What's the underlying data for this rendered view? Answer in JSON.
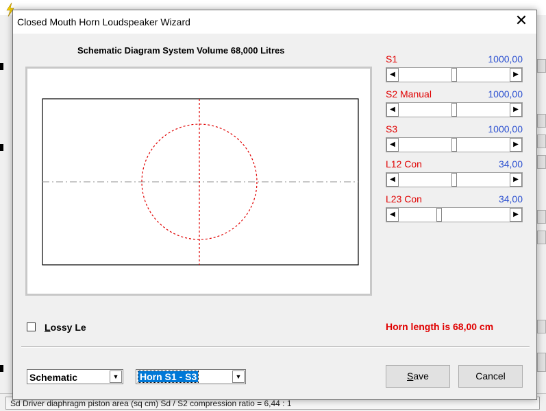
{
  "background": {
    "status_text": "Sd   Driver diaphragm piston area (sq cm)   Sd / S2 compression ratio = 6,44 : 1"
  },
  "dialog": {
    "title": "Closed Mouth Horn Loudspeaker Wizard",
    "close_glyph": "✕",
    "diagram_caption": "Schematic Diagram   System Volume 68,000 Litres",
    "params": [
      {
        "label": "S1",
        "value": "1000,00",
        "position": 0.5
      },
      {
        "label": "S2  Manual",
        "value": "1000,00",
        "position": 0.5
      },
      {
        "label": "S3",
        "value": "1000,00",
        "position": 0.5
      },
      {
        "label": "L12  Con",
        "value": "34,00",
        "position": 0.5
      },
      {
        "label": "L23  Con",
        "value": "34,00",
        "position": 0.36
      }
    ],
    "lossy": {
      "label_prefix": "L",
      "label_rest": "ossy Le",
      "checked": false
    },
    "horn_length": "Horn length is 68,00 cm",
    "view_combo": {
      "value": "Schematic"
    },
    "horn_combo": {
      "value": "Horn S1 - S3"
    },
    "buttons": {
      "save_mnemonic": "S",
      "save_rest": "ave",
      "cancel": "Cancel"
    }
  },
  "colors": {
    "accent_red": "#e00000",
    "value_blue": "#2a4fd0",
    "selection_blue": "#0078d7"
  },
  "icons": {
    "arrow_left": "◀",
    "arrow_right": "▶",
    "arrow_down": "▼"
  }
}
